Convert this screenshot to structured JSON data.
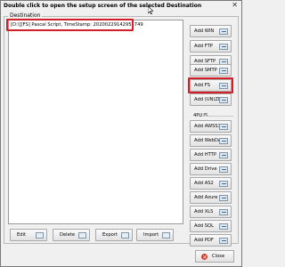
{
  "window": {
    "title": "Double click to open the setup screen of the selected Destination",
    "close_glyph": "✕"
  },
  "destination": {
    "label": "Destination",
    "items": [
      "[D:\\][FS] Pascal Script, TimeStamp: 20200229142951749"
    ]
  },
  "side_buttons": [
    {
      "label": "Add WIN",
      "icon": "arrow-icon"
    },
    {
      "label": "Add FTP",
      "icon": "arrow-icon"
    },
    {
      "label": "Add SFTP",
      "icon": "arrow-icon"
    },
    {
      "label": "Add SMTP",
      "icon": "arrow-icon"
    },
    {
      "label": "Add FS",
      "icon": "arrow-icon"
    },
    {
      "label": "Add (UN)ZIP",
      "icon": "arrow-icon"
    }
  ],
  "plus_section": {
    "label": "4PLUS",
    "buttons": [
      {
        "label": "Add AWSS3",
        "icon": "arrow-icon"
      },
      {
        "label": "Add WebDAV",
        "icon": "arrow-icon"
      },
      {
        "label": "Add HTTP",
        "icon": "arrow-icon"
      },
      {
        "label": "Add Drive",
        "icon": "arrow-icon"
      },
      {
        "label": "Add AS2",
        "icon": "arrow-icon"
      },
      {
        "label": "Add Azure",
        "icon": "arrow-icon"
      },
      {
        "label": "Add XLS",
        "icon": "arrow-icon"
      },
      {
        "label": "Add SQL",
        "icon": "arrow-icon"
      },
      {
        "label": "Add PDF",
        "icon": "arrow-icon"
      }
    ]
  },
  "bottom_buttons": [
    {
      "label": "Edit"
    },
    {
      "label": "Delete"
    },
    {
      "label": "Export"
    },
    {
      "label": "Import"
    }
  ],
  "close_button": {
    "label": "Close"
  },
  "colors": {
    "highlight": "#d31f2a",
    "window_bg": "#f0f0f0"
  }
}
